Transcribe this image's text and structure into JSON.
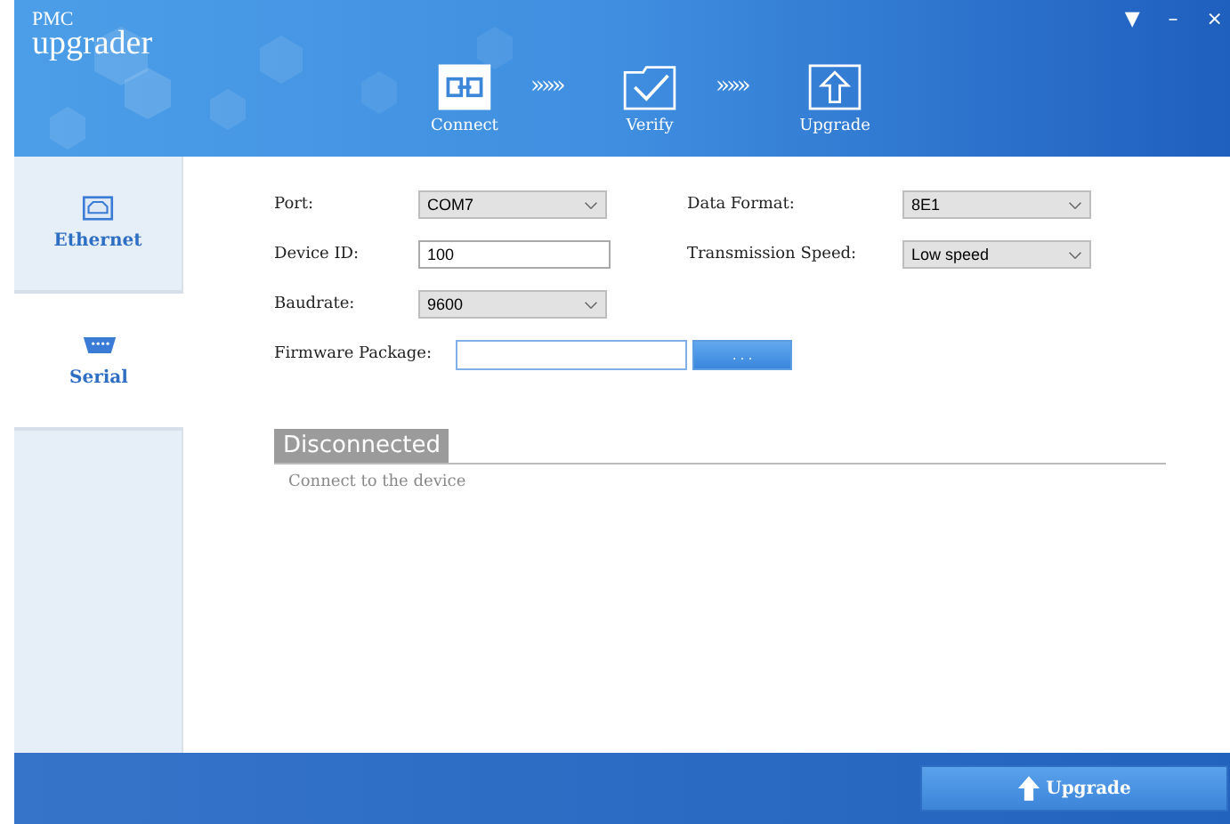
{
  "window": {
    "logo_top": "PMC",
    "logo_bottom": "upgrader",
    "controls": [
      "▼",
      "–",
      "×"
    ]
  },
  "steps": [
    {
      "label": "Connect",
      "kind": "connect",
      "selected": true
    },
    {
      "label": "Verify",
      "kind": "verify",
      "selected": false
    },
    {
      "label": "Upgrade",
      "kind": "upgrade",
      "selected": false
    }
  ],
  "step_separator": "»»»",
  "sidebar": {
    "items": [
      {
        "label": "Ethernet",
        "kind": "ethernet",
        "selected": false
      },
      {
        "label": "Serial",
        "kind": "serial",
        "selected": true
      }
    ]
  },
  "form": {
    "left": [
      {
        "label": "Port:",
        "kind": "dropdown",
        "value": "COM7"
      },
      {
        "label": "Device ID:",
        "kind": "input",
        "value": "100"
      },
      {
        "label": "Baudrate:",
        "kind": "dropdown",
        "value": "9600"
      }
    ],
    "right": [
      {
        "label": "Data Format:",
        "kind": "dropdown",
        "value": "8E1"
      },
      {
        "label": "Transmission Speed:",
        "kind": "dropdown",
        "value": "Low speed"
      }
    ],
    "firmware": {
      "label": "Firmware Package:",
      "browse": ". . ."
    }
  },
  "status": {
    "title": "Disconnected",
    "message": "Connect to the device"
  },
  "footer": {
    "button": "Upgrade"
  }
}
